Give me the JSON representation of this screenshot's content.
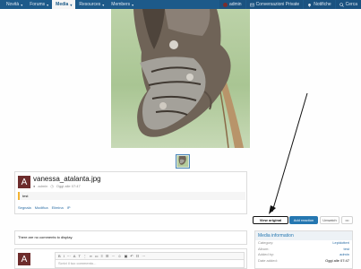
{
  "nav": {
    "items": [
      {
        "label": "Novità",
        "chev": "▾"
      },
      {
        "label": "Forums",
        "chev": "▾"
      },
      {
        "label": "Media",
        "chev": "▾",
        "active": true
      },
      {
        "label": "Resources",
        "chev": "▾"
      },
      {
        "label": "Members",
        "chev": "▾"
      }
    ],
    "user": "admin",
    "conversations": "Conversazioni Private",
    "notifications": "Notifiche",
    "search": "Cerca"
  },
  "media": {
    "title": "vanessa_atalanta.jpg",
    "avatar_letter": "A",
    "author": "admin",
    "date": "Oggi alle 07:47",
    "description": "test",
    "actions": [
      "Segnala",
      "Modifica",
      "Elimina",
      "IP"
    ]
  },
  "buttons": {
    "view_original": "View original",
    "add_reaction": "Add reaction",
    "unwatch": "Unwatch",
    "more": "•••"
  },
  "comments": {
    "empty_text": "There are no comments to display."
  },
  "editor": {
    "avatar_letter": "A",
    "placeholder": "Scrivi il tuo commento...",
    "toolbar": [
      "B",
      "I",
      "⋯",
      "A",
      "T",
      "⋮",
      "∞",
      "▭",
      "≡",
      "☰",
      "⋯",
      "☺",
      "▣",
      "↶",
      "☷",
      "⋯"
    ]
  },
  "info": {
    "heading": "Media information",
    "rows": [
      {
        "key": "Category:",
        "value": "Lepidotteri",
        "link": true
      },
      {
        "key": "Album:",
        "value": "test",
        "link": true
      },
      {
        "key": "Added by:",
        "value": "admin",
        "link": true
      },
      {
        "key": "Date added:",
        "value": "Oggi alle 07:47",
        "link": false
      }
    ]
  },
  "colors": {
    "nav_bg": "#1d5a8a",
    "accent": "#2577b1",
    "highlight": "#f3b332"
  }
}
